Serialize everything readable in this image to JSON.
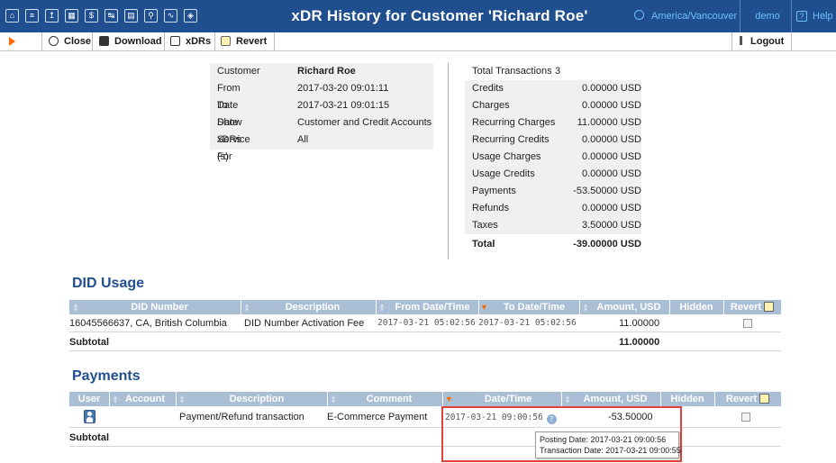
{
  "window": {
    "title": "xDR History for Customer 'Richard Roe'",
    "timezone": "America/Vancouver",
    "user": "demo",
    "help": "Help",
    "toolbar_icons": [
      "home-icon",
      "list-icon",
      "upload-icon",
      "grid-icon",
      "dollar-icon",
      "transfer-icon",
      "sim-icon",
      "search-icon",
      "chart-icon",
      "shield-icon"
    ]
  },
  "toolbar": {
    "close": "Close",
    "download": "Download",
    "xdrs": "xDRs",
    "revert": "Revert",
    "logout": "Logout"
  },
  "info": {
    "customer_label": "Customer",
    "customer": "Richard Roe",
    "from_label": "From Date",
    "from": "2017-03-20 09:01:11",
    "to_label": "To Date",
    "to": "2017-03-21 09:01:15",
    "show_label": "Show xDRs For",
    "show": "Customer and Credit Accounts",
    "service_label": "Service (s)",
    "service": "All"
  },
  "totals": [
    {
      "label": "Total Transactions",
      "value": "3"
    },
    {
      "label": "Credits",
      "value": "0.00000 USD"
    },
    {
      "label": "Charges",
      "value": "0.00000 USD"
    },
    {
      "label": "Recurring Charges",
      "value": "11.00000 USD"
    },
    {
      "label": "Recurring Credits",
      "value": "0.00000 USD"
    },
    {
      "label": "Usage Charges",
      "value": "0.00000 USD"
    },
    {
      "label": "Usage Credits",
      "value": "0.00000 USD"
    },
    {
      "label": "Payments",
      "value": "-53.50000 USD"
    },
    {
      "label": "Refunds",
      "value": "0.00000 USD"
    },
    {
      "label": "Taxes",
      "value": "3.50000 USD"
    },
    {
      "label": "Total",
      "value": "-39.00000 USD"
    }
  ],
  "did": {
    "title": "DID Usage",
    "headers": {
      "did_number": "DID Number",
      "description": "Description",
      "from": "From Date/Time",
      "to": "To Date/Time",
      "amount": "Amount, USD",
      "hidden": "Hidden",
      "revert": "Revert"
    },
    "row": {
      "did_number": "16045566637, CA, British Columbia",
      "description": "DID Number Activation Fee",
      "from": "2017-03-21 05:02:56",
      "to": "2017-03-21 05:02:56",
      "amount": "11.00000"
    },
    "subtotal_label": "Subtotal",
    "subtotal": "11.00000"
  },
  "payments": {
    "title": "Payments",
    "headers": {
      "user": "User",
      "account": "Account",
      "description": "Description",
      "comment": "Comment",
      "datetime": "Date/Time",
      "amount": "Amount, USD",
      "hidden": "Hidden",
      "revert": "Revert"
    },
    "row": {
      "description": "Payment/Refund transaction",
      "comment": "E-Commerce Payment",
      "datetime": "2017-03-21 09:00:56",
      "amount": "-53.50000"
    },
    "subtotal_label": "Subtotal",
    "tooltip": {
      "posting": "Posting Date: 2017-03-21 09:00:56",
      "transaction": "Transaction Date: 2017-03-21 09:00:55"
    }
  },
  "colors": {
    "header_bar": "#1f4f8e",
    "table_header": "#aabfd5",
    "section_title": "#1f4f8e",
    "highlight": "#e0413a",
    "accent_orange": "#ff6a00"
  }
}
